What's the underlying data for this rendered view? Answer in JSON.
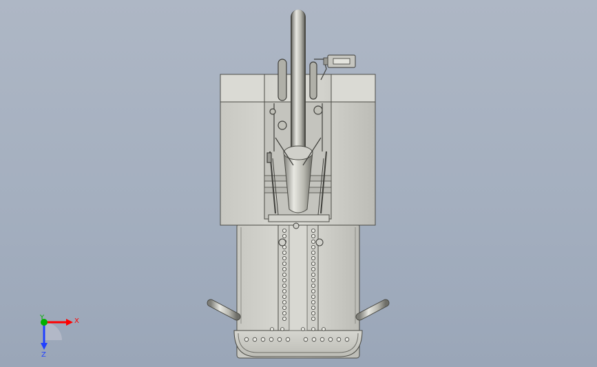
{
  "window": {
    "type": "cad-3d-viewport"
  },
  "model": {
    "icon": "equipment-frame-assembly-icon",
    "colors": {
      "shell": "#d8d8d2",
      "shell_dark": "#9c9c94",
      "edge": "#4a4a44",
      "tube": "#c8c8c0",
      "background_top": "#aeb7c5",
      "background_bottom": "#9aa6b8"
    }
  },
  "triad": {
    "icon": "axis-triad-icon",
    "x_label": "X",
    "y_label": "Y",
    "z_label": "Z",
    "colors": {
      "x": "#ff0000",
      "y": "#00b000",
      "z": "#2040ff"
    }
  }
}
